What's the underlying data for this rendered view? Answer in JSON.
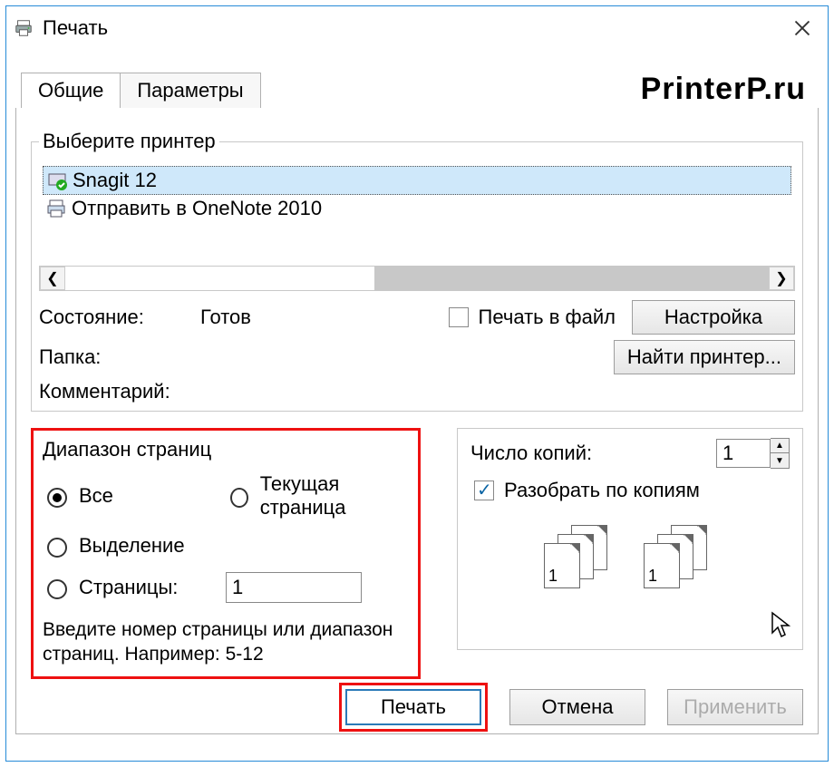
{
  "window": {
    "title": "Печать"
  },
  "watermark": "PrinterP.ru",
  "tabs": {
    "general": "Общие",
    "parameters": "Параметры"
  },
  "printerGroup": {
    "legend": "Выберите принтер",
    "items": [
      {
        "name": "Snagit 12",
        "selected": true
      },
      {
        "name": "Отправить в OneNote 2010",
        "selected": false
      }
    ]
  },
  "status": {
    "stateLabel": "Состояние:",
    "stateValue": "Готов",
    "folderLabel": "Папка:",
    "commentLabel": "Комментарий:",
    "printToFile": "Печать в файл",
    "setupBtn": "Настройка",
    "findPrinterBtn": "Найти принтер..."
  },
  "range": {
    "legend": "Диапазон страниц",
    "all": "Все",
    "current": "Текущая страница",
    "selection": "Выделение",
    "pages": "Страницы:",
    "pagesValue": "1",
    "hint": "Введите номер страницы или диапазон страниц.  Например: 5-12"
  },
  "copies": {
    "label": "Число копий:",
    "value": "1",
    "collate": "Разобрать по копиям"
  },
  "footer": {
    "print": "Печать",
    "cancel": "Отмена",
    "apply": "Применить"
  }
}
